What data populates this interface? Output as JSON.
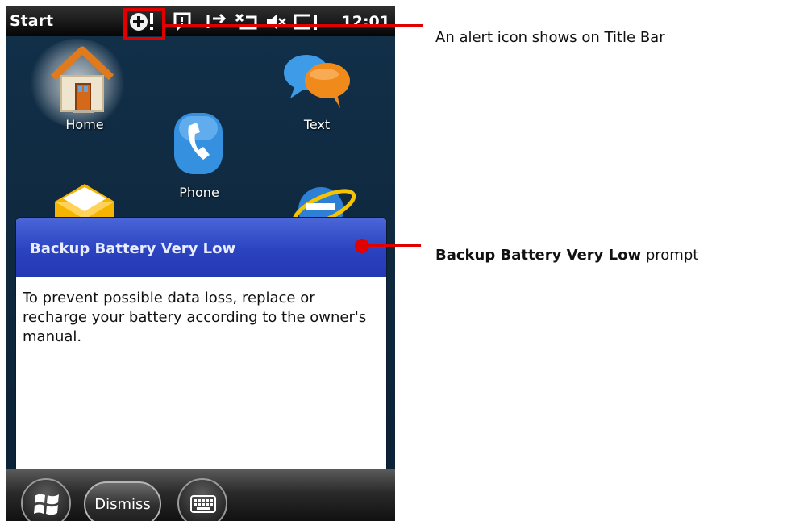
{
  "titlebar": {
    "start_label": "Start",
    "time": "12:01",
    "icons": [
      "alert-icon",
      "notification-icon",
      "connectivity-icon",
      "no-signal-icon",
      "volume-muted-icon",
      "battery-low-icon"
    ]
  },
  "start_screen": {
    "apps": [
      {
        "label": "Home",
        "icon": "home-icon"
      },
      {
        "label": "Text",
        "icon": "text-message-icon"
      },
      {
        "label": "Phone",
        "icon": "phone-icon"
      },
      {
        "label": "",
        "icon": "email-icon"
      },
      {
        "label": "",
        "icon": "internet-explorer-icon"
      }
    ]
  },
  "dialog": {
    "title": "Backup Battery Very Low",
    "body": "To prevent possible data loss, replace or recharge your battery according to the owner's manual."
  },
  "softkeys": {
    "dismiss_label": "Dismiss",
    "start_icon": "windows-logo-icon",
    "keyboard_icon": "keyboard-icon"
  },
  "annotations": {
    "alert_note": "An alert icon shows on Title Bar",
    "prompt_bold": "Backup Battery Very Low",
    "prompt_suffix": " prompt"
  },
  "colors": {
    "callout_red": "#e00000",
    "dialog_header_blue": "#2b43c0",
    "titlebar_black": "#050505"
  }
}
